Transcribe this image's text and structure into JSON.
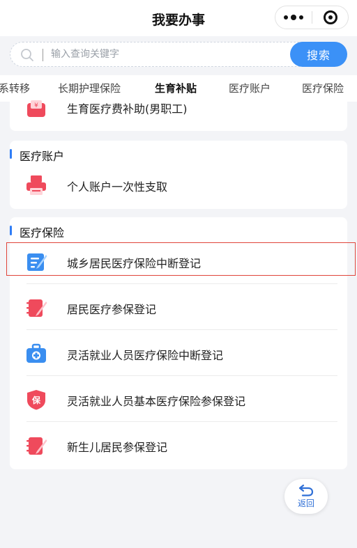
{
  "header": {
    "title": "我要办事"
  },
  "search": {
    "placeholder": "输入查询关键字",
    "button_label": "搜索"
  },
  "tabs": [
    {
      "label": "系转移",
      "active": false
    },
    {
      "label": "长期护理保险",
      "active": false
    },
    {
      "label": "生育补贴",
      "active": true
    },
    {
      "label": "医疗账户",
      "active": false
    },
    {
      "label": "医疗保险",
      "active": false
    }
  ],
  "top_card": {
    "item_label": "生育医疗费补助(男职工)",
    "icon": "red-wallet-icon"
  },
  "account_section": {
    "title": "医疗账户",
    "items": [
      {
        "label": "个人账户一次性支取",
        "icon": "red-printer-icon"
      }
    ]
  },
  "insurance_section": {
    "title": "医疗保险",
    "items": [
      {
        "label": "城乡居民医疗保险中断登记",
        "icon": "blue-notepad-icon"
      },
      {
        "label": "居民医疗参保登记",
        "icon": "red-notebook-icon"
      },
      {
        "label": "灵活就业人员医疗保险中断登记",
        "icon": "blue-medkit-icon"
      },
      {
        "label": "灵活就业人员基本医疗保险参保登记",
        "icon": "red-shield-icon"
      },
      {
        "label": "新生儿居民参保登记",
        "icon": "red-notebook-icon"
      }
    ]
  },
  "back_button": {
    "label": "返回"
  },
  "colors": {
    "accent": "#3b91f7",
    "highlight": "#e0443a",
    "icon_red": "#ef4a5c",
    "icon_blue": "#3a8ef0"
  }
}
